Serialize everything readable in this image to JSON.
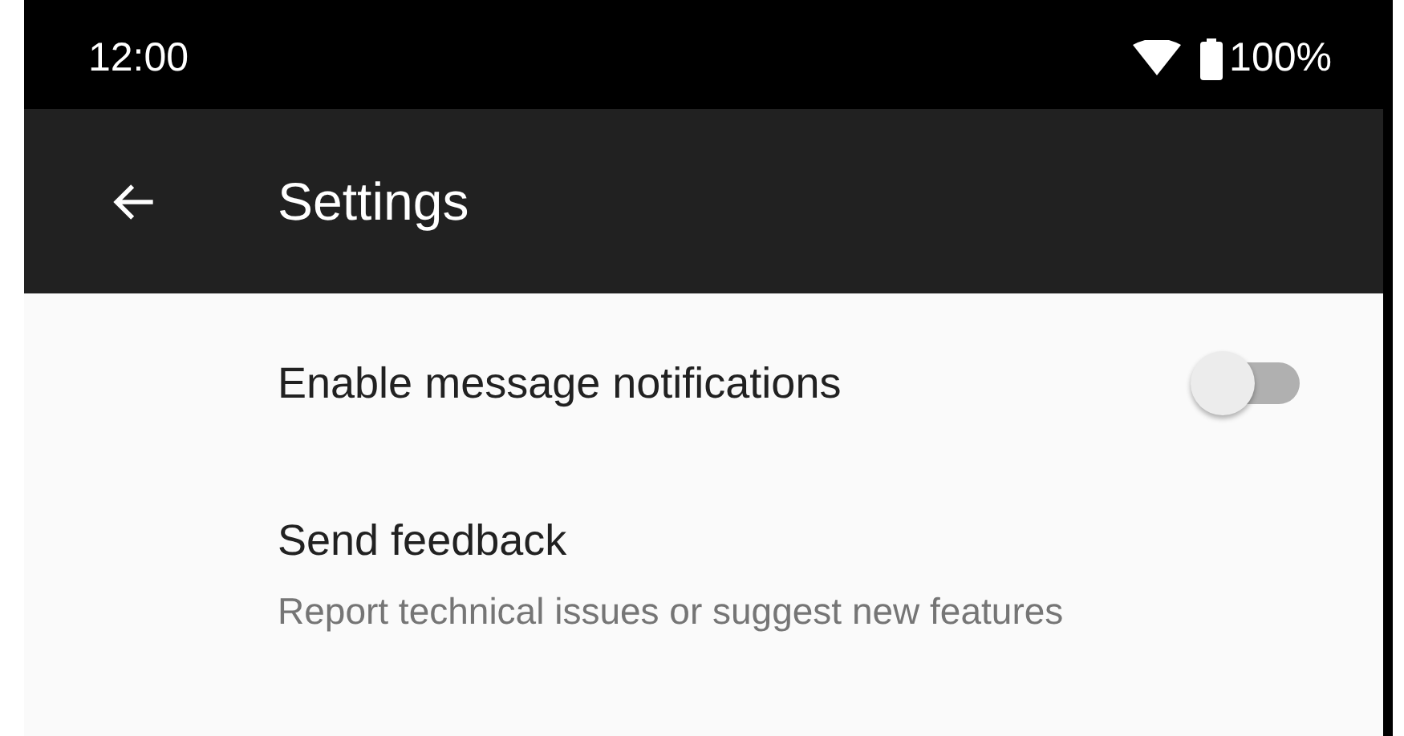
{
  "status_bar": {
    "time": "12:00",
    "battery": "100%"
  },
  "app_bar": {
    "title": "Settings"
  },
  "settings": [
    {
      "kind": "switch",
      "title": "Enable message notifications",
      "on": false
    },
    {
      "kind": "text",
      "title": "Send feedback",
      "summary": "Report technical issues or suggest new features"
    }
  ]
}
